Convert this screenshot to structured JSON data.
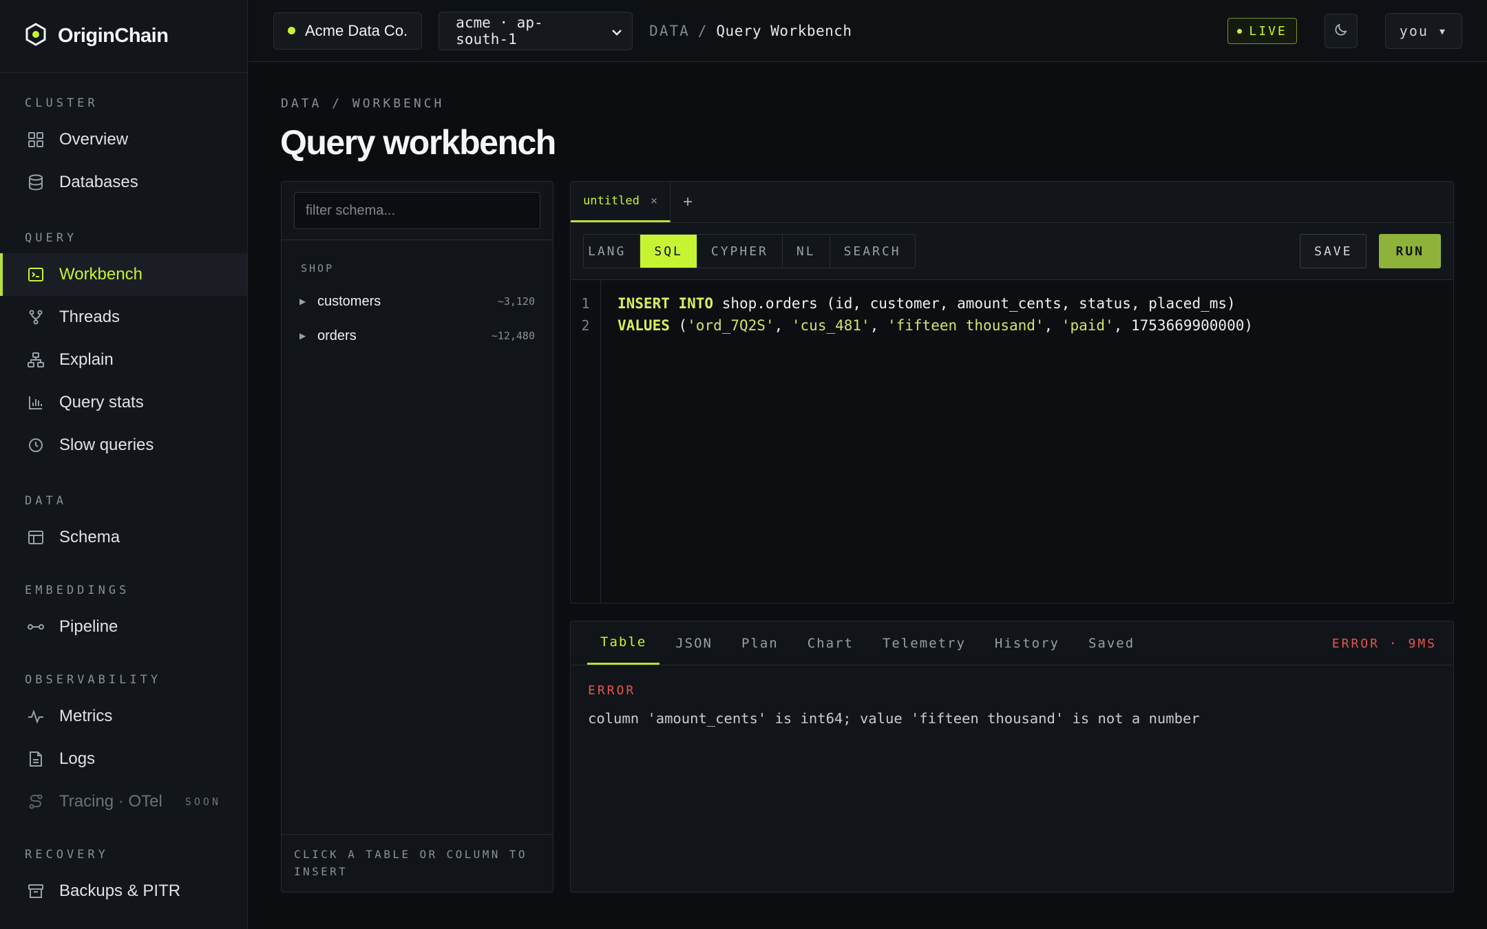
{
  "brand": {
    "name": "OriginChain"
  },
  "sidebar": {
    "sections": [
      {
        "title": "CLUSTER",
        "items": [
          {
            "label": "Overview",
            "icon": "grid-icon"
          },
          {
            "label": "Databases",
            "icon": "database-icon"
          }
        ]
      },
      {
        "title": "QUERY",
        "items": [
          {
            "label": "Workbench",
            "icon": "terminal-icon",
            "active": true
          },
          {
            "label": "Threads",
            "icon": "branch-icon"
          },
          {
            "label": "Explain",
            "icon": "hierarchy-icon"
          },
          {
            "label": "Query stats",
            "icon": "bar-chart-icon"
          },
          {
            "label": "Slow queries",
            "icon": "clock-icon"
          }
        ]
      },
      {
        "title": "DATA",
        "items": [
          {
            "label": "Schema",
            "icon": "table-icon"
          }
        ]
      },
      {
        "title": "EMBEDDINGS",
        "items": [
          {
            "label": "Pipeline",
            "icon": "pipeline-icon"
          }
        ]
      },
      {
        "title": "OBSERVABILITY",
        "items": [
          {
            "label": "Metrics",
            "icon": "pulse-icon"
          },
          {
            "label": "Logs",
            "icon": "document-icon"
          },
          {
            "label": "Tracing · OTel",
            "icon": "trace-icon",
            "disabled": true,
            "badge": "SOON"
          }
        ]
      },
      {
        "title": "RECOVERY",
        "items": [
          {
            "label": "Backups & PITR",
            "icon": "archive-icon"
          }
        ]
      }
    ]
  },
  "topbar": {
    "org": "Acme Data Co.",
    "region": "acme · ap-south-1",
    "crumb_root": "DATA",
    "crumb_sep": "/",
    "crumb_current": "Query Workbench",
    "live": "LIVE",
    "user": "you ▾"
  },
  "page": {
    "crumb": "DATA / WORKBENCH",
    "title": "Query workbench"
  },
  "schema": {
    "placeholder": "filter schema...",
    "group": "SHOP",
    "tables": [
      {
        "name": "customers",
        "count": "~3,120"
      },
      {
        "name": "orders",
        "count": "~12,480"
      }
    ],
    "footer": "CLICK A TABLE OR COLUMN TO INSERT"
  },
  "editor": {
    "tab": "untitled",
    "tab_close": "×",
    "add_tab": "+",
    "lang_label": "LANG",
    "langs": [
      "SQL",
      "CYPHER",
      "NL",
      "SEARCH"
    ],
    "active_lang": "SQL",
    "save": "SAVE",
    "run": "RUN",
    "lines": [
      "1",
      "2"
    ]
  },
  "results": {
    "tabs": [
      "Table",
      "JSON",
      "Plan",
      "Chart",
      "Telemetry",
      "History",
      "Saved"
    ],
    "active_tab": "Table",
    "status": "ERROR · 9MS",
    "error_label": "ERROR",
    "error_message": "column 'amount_cents' is int64; value 'fifteen thousand' is not a number"
  },
  "colors": {
    "accent": "#c6f432",
    "error": "#e5554f",
    "background": "#0b0d10"
  }
}
